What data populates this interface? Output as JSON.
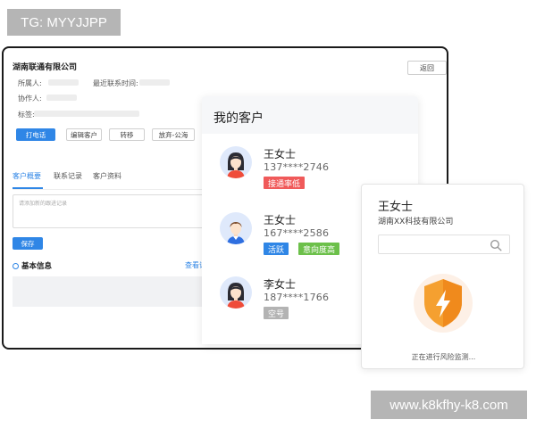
{
  "watermarks": {
    "tag": "TG: MYYJJPP",
    "url": "www.k8kfhy-k8.com"
  },
  "crm": {
    "company": "湖南联通有限公司",
    "back_label": "返回",
    "fields": {
      "owner": "所属人:",
      "last_contact": "最近联系时间:",
      "collaborator": "协作人:",
      "tags": "标签:"
    },
    "actions": {
      "call": "打电话",
      "edit": "编辑客户",
      "transfer": "转移",
      "abandon": "放弃-公海"
    },
    "tabs": {
      "overview": "客户概要",
      "records": "联系记录",
      "profile": "客户资料"
    },
    "textarea_placeholder": "请添加新的跟进记录",
    "save_label": "保存",
    "basic_info": "基本信息",
    "view_link": "查看详"
  },
  "panel": {
    "title": "我的客户",
    "customers": [
      {
        "name": "王女士",
        "phone": "137****2746",
        "tags": [
          {
            "label": "接通率低",
            "color": "#f05a5a"
          }
        ]
      },
      {
        "name": "王女士",
        "phone": "167****2586",
        "tags": [
          {
            "label": "活跃",
            "color": "#2f86e6"
          },
          {
            "label": "意向度高",
            "color": "#6cc04a"
          }
        ]
      },
      {
        "name": "李女士",
        "phone": "187****1766",
        "tags": [
          {
            "label": "空号",
            "color": "#b3b3b3"
          }
        ]
      }
    ]
  },
  "detail": {
    "name": "王女士",
    "company": "湖南XX科技有限公司",
    "status": "正在进行风险监测..."
  },
  "colors": {
    "accent": "#2f86e6",
    "shield": "#f5a030"
  }
}
